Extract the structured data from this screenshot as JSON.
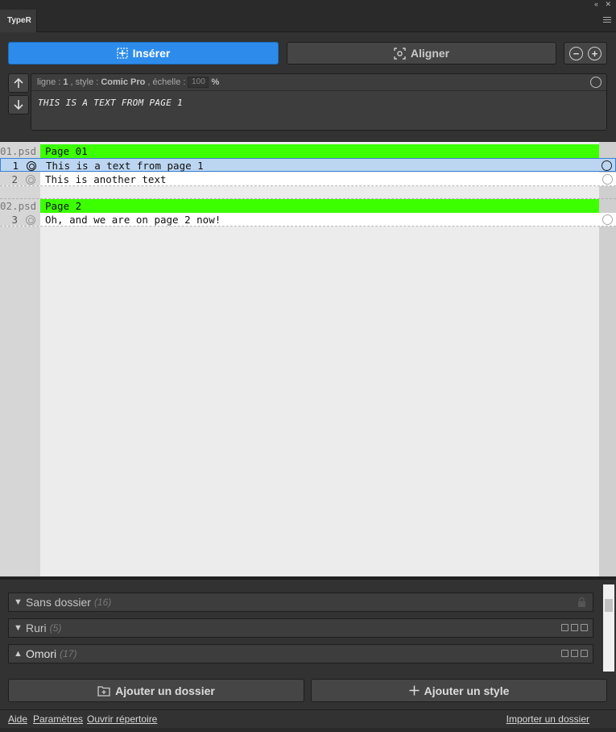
{
  "app": {
    "tab_label": "TypeR"
  },
  "toolbar": {
    "insert_label": "Insérer",
    "align_label": "Aligner"
  },
  "info": {
    "line_prefix": "ligne : ",
    "line_value": "1",
    "style_prefix": ", style : ",
    "style_value": "Comic Pro",
    "scale_prefix": ", échelle : ",
    "scale_value": "100",
    "scale_unit": "%",
    "current_text": "THIS IS A TEXT FROM PAGE 1"
  },
  "pages": [
    {
      "file": "01.psd",
      "title": "Page 01",
      "lines": [
        {
          "num": "1",
          "text": "This is a text from page 1",
          "selected": true
        },
        {
          "num": "2",
          "text": "This is another text",
          "selected": false
        }
      ]
    },
    {
      "file": "02.psd",
      "title": "Page 2",
      "lines": [
        {
          "num": "3",
          "text": "Oh, and we are on page 2 now!",
          "selected": false
        }
      ]
    }
  ],
  "folders": [
    {
      "name": "Sans dossier",
      "count": "(16)",
      "expanded": false
    },
    {
      "name": "Ruri",
      "count": "(5)",
      "expanded": false
    },
    {
      "name": "Omori",
      "count": "(17)",
      "expanded": true
    }
  ],
  "actions": {
    "add_folder": "Ajouter un dossier",
    "add_style": "Ajouter un style"
  },
  "footer": {
    "help": "Aide",
    "settings": "Paramètres",
    "open_dir": "Ouvrir répertoire",
    "import_folder": "Importer un dossier"
  }
}
